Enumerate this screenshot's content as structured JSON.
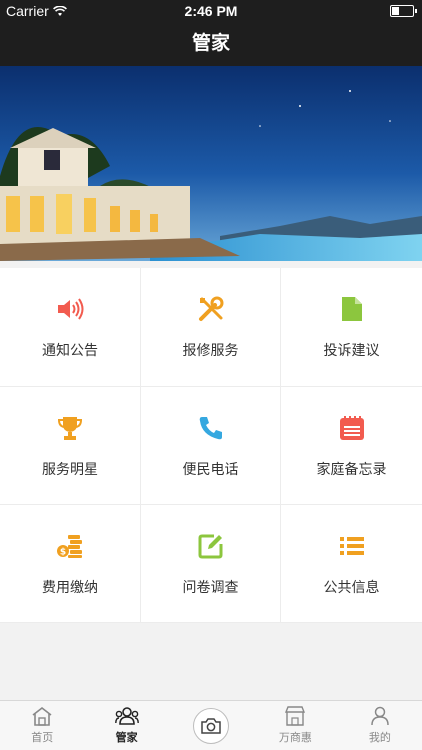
{
  "status_bar": {
    "carrier": "Carrier",
    "time": "2:46 PM",
    "battery_level": 0.35
  },
  "nav": {
    "title": "管家"
  },
  "banner": {
    "icon": "resort-villa-night-photo"
  },
  "grid": [
    {
      "label": "通知公告",
      "icon": "speaker-icon",
      "color": "#f25b4f"
    },
    {
      "label": "报修服务",
      "icon": "tools-icon",
      "color": "#f0a020"
    },
    {
      "label": "投诉建议",
      "icon": "document-icon",
      "color": "#8cc63e"
    },
    {
      "label": "服务明星",
      "icon": "trophy-icon",
      "color": "#f0a020"
    },
    {
      "label": "便民电话",
      "icon": "phone-icon",
      "color": "#35a8e0"
    },
    {
      "label": "家庭备忘录",
      "icon": "notepad-icon",
      "color": "#f25b4f"
    },
    {
      "label": "费用缴纳",
      "icon": "coins-icon",
      "color": "#f0a020"
    },
    {
      "label": "问卷调查",
      "icon": "edit-icon",
      "color": "#8cc63e"
    },
    {
      "label": "公共信息",
      "icon": "list-icon",
      "color": "#f0a020"
    }
  ],
  "tabs": [
    {
      "label": "首页",
      "icon": "home-icon",
      "active": false
    },
    {
      "label": "管家",
      "icon": "people-icon",
      "active": true
    },
    {
      "label": "",
      "icon": "camera-icon",
      "active": false
    },
    {
      "label": "万商惠",
      "icon": "shop-icon",
      "active": false
    },
    {
      "label": "我的",
      "icon": "user-icon",
      "active": false
    }
  ]
}
